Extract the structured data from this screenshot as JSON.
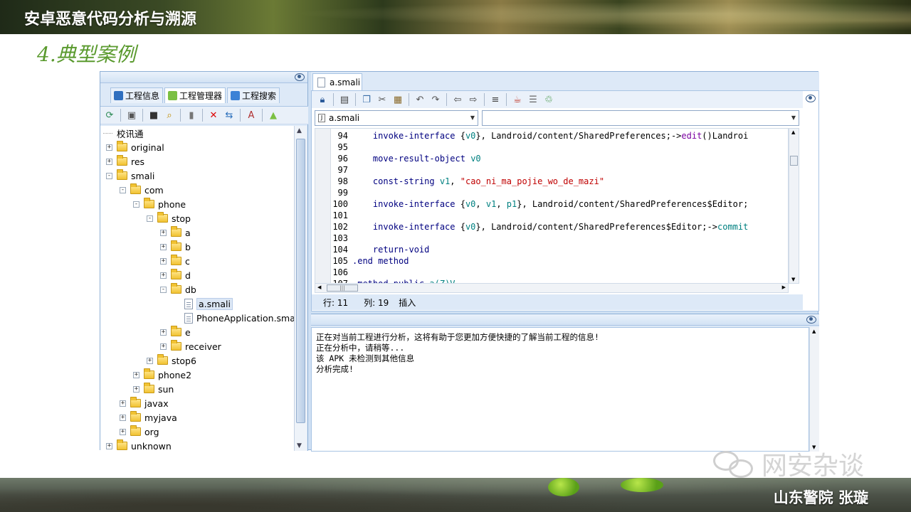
{
  "slide": {
    "title": "安卓恶意代码分析与溯源",
    "section": "4.典型案例",
    "author": "山东警院  张璇",
    "watermark": "网安杂谈"
  },
  "left_tabs": [
    {
      "label": "工程信息",
      "icon": "info-icon"
    },
    {
      "label": "工程管理器",
      "icon": "android-icon"
    },
    {
      "label": "工程搜索",
      "icon": "search-icon"
    }
  ],
  "left_toolbar_icons": [
    "refresh-icon",
    "import-icon",
    "window-icon",
    "find-icon",
    "bookmark-icon",
    "delete-icon",
    "export-icon",
    "apk-icon",
    "android-icon"
  ],
  "tree": [
    {
      "label": "校讯通",
      "depth": 0,
      "type": "root"
    },
    {
      "label": "original",
      "depth": 0,
      "type": "folder",
      "expander": "+"
    },
    {
      "label": "res",
      "depth": 0,
      "type": "folder",
      "expander": "+"
    },
    {
      "label": "smali",
      "depth": 0,
      "type": "folder",
      "expander": "-"
    },
    {
      "label": "com",
      "depth": 1,
      "type": "folder",
      "expander": "-"
    },
    {
      "label": "phone",
      "depth": 2,
      "type": "folder",
      "expander": "-"
    },
    {
      "label": "stop",
      "depth": 3,
      "type": "folder",
      "expander": "-"
    },
    {
      "label": "a",
      "depth": 4,
      "type": "folder",
      "expander": "+"
    },
    {
      "label": "b",
      "depth": 4,
      "type": "folder",
      "expander": "+"
    },
    {
      "label": "c",
      "depth": 4,
      "type": "folder",
      "expander": "+"
    },
    {
      "label": "d",
      "depth": 4,
      "type": "folder",
      "expander": "+"
    },
    {
      "label": "db",
      "depth": 4,
      "type": "folder",
      "expander": "-"
    },
    {
      "label": "a.smali",
      "depth": 5,
      "type": "file",
      "selected": true
    },
    {
      "label": "PhoneApplication.smal",
      "depth": 5,
      "type": "file"
    },
    {
      "label": "e",
      "depth": 4,
      "type": "folder",
      "expander": "+"
    },
    {
      "label": "receiver",
      "depth": 4,
      "type": "folder",
      "expander": "+"
    },
    {
      "label": "stop6",
      "depth": 3,
      "type": "folder",
      "expander": "+"
    },
    {
      "label": "phone2",
      "depth": 2,
      "type": "folder",
      "expander": "+"
    },
    {
      "label": "sun",
      "depth": 2,
      "type": "folder",
      "expander": "+"
    },
    {
      "label": "javax",
      "depth": 1,
      "type": "folder",
      "expander": "+"
    },
    {
      "label": "myjava",
      "depth": 1,
      "type": "folder",
      "expander": "+"
    },
    {
      "label": "org",
      "depth": 1,
      "type": "folder",
      "expander": "+"
    },
    {
      "label": "unknown",
      "depth": 0,
      "type": "folder",
      "expander": "+"
    }
  ],
  "editor": {
    "tab_label": "a.smali",
    "file_combo": "a.smali",
    "method_combo": "",
    "toolbar_icons": [
      "lock-icon",
      "save-icon",
      "copy-icon",
      "cut-icon",
      "paste-icon",
      "undo-icon",
      "redo-icon",
      "back-icon",
      "forward-icon",
      "format-icon",
      "java-icon",
      "list-icon",
      "jar-icon"
    ],
    "lines": [
      {
        "n": "94",
        "parts": [
          [
            "",
            "    "
          ],
          [
            "kw",
            "invoke-interface"
          ],
          [
            "",
            " {"
          ],
          [
            "reg",
            "v0"
          ],
          [
            "",
            "}, Landroid/content/SharedPreferences;->"
          ],
          [
            "meth",
            "edit"
          ],
          [
            "",
            "()Landroi"
          ]
        ]
      },
      {
        "n": "95",
        "parts": []
      },
      {
        "n": "96",
        "parts": [
          [
            "",
            "    "
          ],
          [
            "kw",
            "move-result-object"
          ],
          [
            "",
            " "
          ],
          [
            "reg",
            "v0"
          ]
        ]
      },
      {
        "n": "97",
        "parts": []
      },
      {
        "n": "98",
        "parts": [
          [
            "",
            "    "
          ],
          [
            "kw",
            "const-string"
          ],
          [
            "",
            " "
          ],
          [
            "reg",
            "v1"
          ],
          [
            "",
            ", "
          ],
          [
            "str",
            "\"cao_ni_ma_pojie_wo_de_mazi\""
          ]
        ]
      },
      {
        "n": "99",
        "parts": []
      },
      {
        "n": "100",
        "parts": [
          [
            "",
            "    "
          ],
          [
            "kw",
            "invoke-interface"
          ],
          [
            "",
            " {"
          ],
          [
            "reg",
            "v0"
          ],
          [
            "",
            ", "
          ],
          [
            "reg",
            "v1"
          ],
          [
            "",
            ", "
          ],
          [
            "reg",
            "p1"
          ],
          [
            "",
            "}, Landroid/content/SharedPreferences$Editor;"
          ]
        ]
      },
      {
        "n": "101",
        "parts": []
      },
      {
        "n": "102",
        "parts": [
          [
            "",
            "    "
          ],
          [
            "kw",
            "invoke-interface"
          ],
          [
            "",
            " {"
          ],
          [
            "reg",
            "v0"
          ],
          [
            "",
            "}, Landroid/content/SharedPreferences$Editor;->"
          ],
          [
            "call",
            "commit"
          ]
        ]
      },
      {
        "n": "103",
        "parts": []
      },
      {
        "n": "104",
        "parts": [
          [
            "",
            "    "
          ],
          [
            "kw",
            "return-void"
          ]
        ]
      },
      {
        "n": "105",
        "parts": [
          [
            "kw",
            ".end method"
          ]
        ]
      },
      {
        "n": "106",
        "parts": []
      },
      {
        "n": "107",
        "parts": [
          [
            "kw",
            ".method public"
          ],
          [
            "",
            " "
          ],
          [
            "call",
            "a(Z)V"
          ]
        ]
      }
    ],
    "status": {
      "line": "行: 11",
      "col": "列: 19",
      "mode": "插入"
    }
  },
  "output": {
    "lines": [
      "正在对当前工程进行分析，这将有助于您更加方便快捷的了解当前工程的信息!",
      "正在分析中，请稍等...",
      "该 APK 未检测到其他信息",
      "分析完成!"
    ]
  },
  "colors": {
    "accent": "#5a9a2e",
    "panel": "#dde9f7",
    "border": "#8fb0d6"
  }
}
